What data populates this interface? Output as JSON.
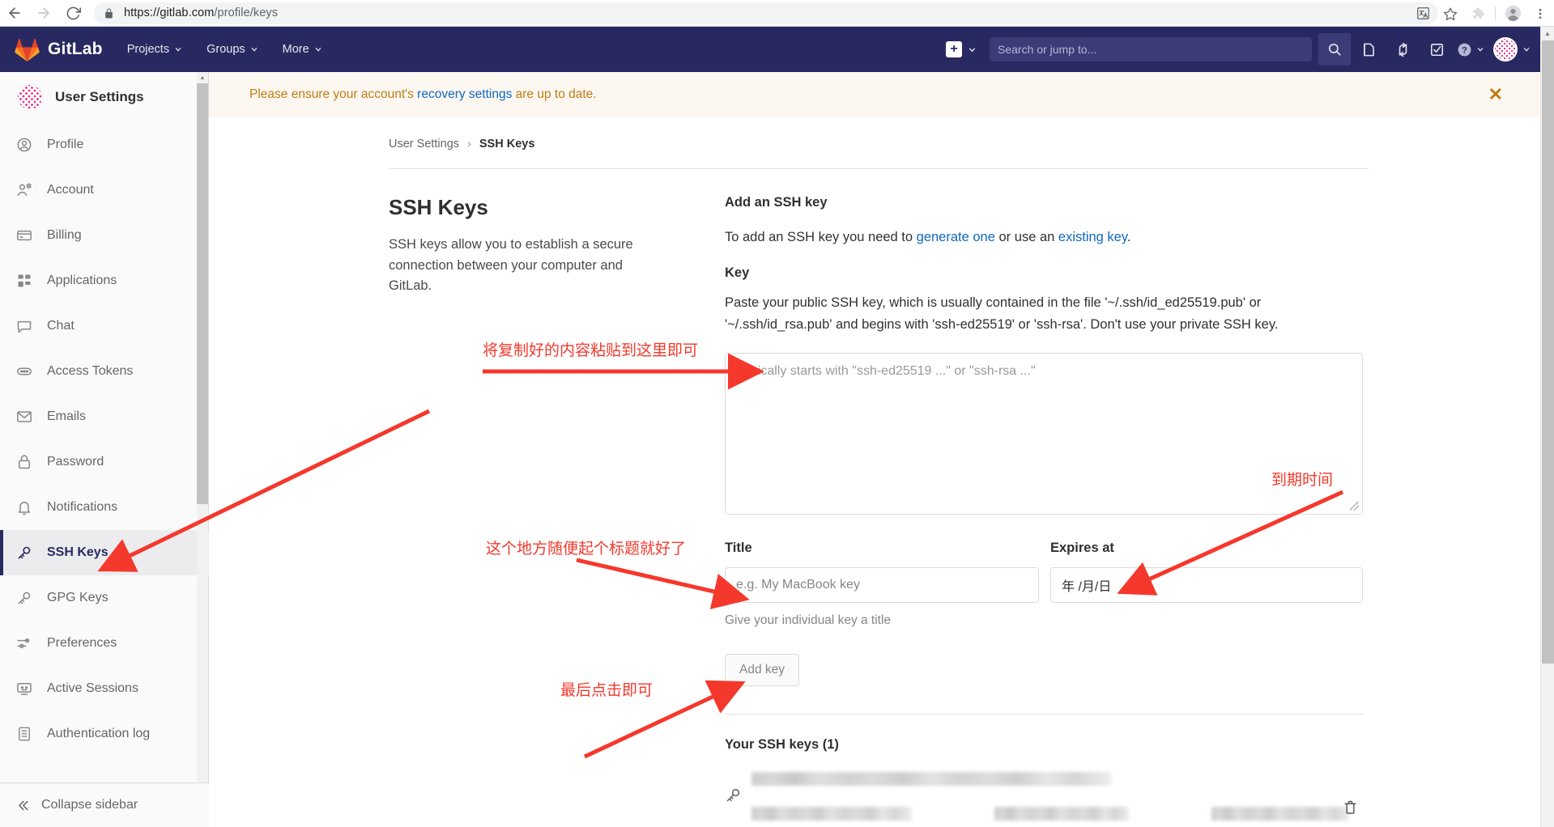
{
  "browser": {
    "back_icon": "back-arrow-icon",
    "forward_icon": "forward-arrow-icon",
    "reload_icon": "reload-icon",
    "lock_icon": "lock-icon",
    "url_secure": "https://gitlab.com",
    "url_path": "/profile/keys",
    "translate_icon": "translate-icon",
    "bookmark_icon": "star-icon",
    "extensions_icon": "extensions-puzzle-icon",
    "profile_icon": "browser-profile-icon",
    "menu_icon": "three-dot-menu-icon"
  },
  "navbar": {
    "brand": "GitLab",
    "menus": [
      "Projects",
      "Groups",
      "More"
    ],
    "new_plus_label": "+",
    "search_placeholder": "Search or jump to...",
    "icons": [
      "search-icon",
      "issues-icon",
      "merge-requests-icon",
      "todos-icon",
      "help-icon",
      "user-avatar"
    ],
    "background": "#292961"
  },
  "sidebar": {
    "title": "User Settings",
    "items": [
      {
        "label": "Profile",
        "icon": "profile-icon",
        "active": false
      },
      {
        "label": "Account",
        "icon": "account-icon",
        "active": false
      },
      {
        "label": "Billing",
        "icon": "credit-card-icon",
        "active": false
      },
      {
        "label": "Applications",
        "icon": "applications-icon",
        "active": false
      },
      {
        "label": "Chat",
        "icon": "chat-icon",
        "active": false
      },
      {
        "label": "Access Tokens",
        "icon": "token-icon",
        "active": false
      },
      {
        "label": "Emails",
        "icon": "envelope-icon",
        "active": false
      },
      {
        "label": "Password",
        "icon": "lock-icon",
        "active": false
      },
      {
        "label": "Notifications",
        "icon": "bell-icon",
        "active": false
      },
      {
        "label": "SSH Keys",
        "icon": "key-icon",
        "active": true
      },
      {
        "label": "GPG Keys",
        "icon": "key-icon",
        "active": false
      },
      {
        "label": "Preferences",
        "icon": "sliders-icon",
        "active": false
      },
      {
        "label": "Active Sessions",
        "icon": "monitor-icon",
        "active": false
      },
      {
        "label": "Authentication log",
        "icon": "log-icon",
        "active": false
      }
    ],
    "collapse_label": "Collapse sidebar",
    "collapse_icon": "double-chevron-left-icon"
  },
  "alert": {
    "text_before": "Please ensure your account's ",
    "link": "recovery settings",
    "text_after": " are up to date.",
    "close_icon": "close-icon",
    "accent": "#c17d10",
    "background": "#fdf7f2"
  },
  "breadcrumb": {
    "parent": "User Settings",
    "separator": "›",
    "current": "SSH Keys"
  },
  "page": {
    "title": "SSH Keys",
    "description": "SSH keys allow you to establish a secure connection between your computer and GitLab."
  },
  "add_key": {
    "heading": "Add an SSH key",
    "intro_before": "To add an SSH key you need to ",
    "intro_link1": "generate one",
    "intro_middle": " or use an ",
    "intro_link2": "existing key",
    "intro_after": ".",
    "key_label": "Key",
    "key_help": "Paste your public SSH key, which is usually contained in the file '~/.ssh/id_ed25519.pub' or '~/.ssh/id_rsa.pub' and begins with 'ssh-ed25519' or 'ssh-rsa'. Don't use your private SSH key.",
    "key_placeholder": "Typically starts with \"ssh-ed25519 ...\" or \"ssh-rsa ...\"",
    "title_label": "Title",
    "title_placeholder": "e.g. My MacBook key",
    "title_help": "Give your individual key a title",
    "expires_label": "Expires at",
    "expires_value": "年 /月/日",
    "submit_label": "Add key"
  },
  "keys_list": {
    "heading": "Your SSH keys (1)",
    "key_icon": "key-icon",
    "delete_icon": "trash-icon"
  },
  "annotations": {
    "paste_here": "将复制好的内容粘贴到这里即可",
    "any_title": "这个地方随便起个标题就好了",
    "expire_time": "到期时间",
    "finally_click": "最后点击即可",
    "color": "#f5382c"
  }
}
